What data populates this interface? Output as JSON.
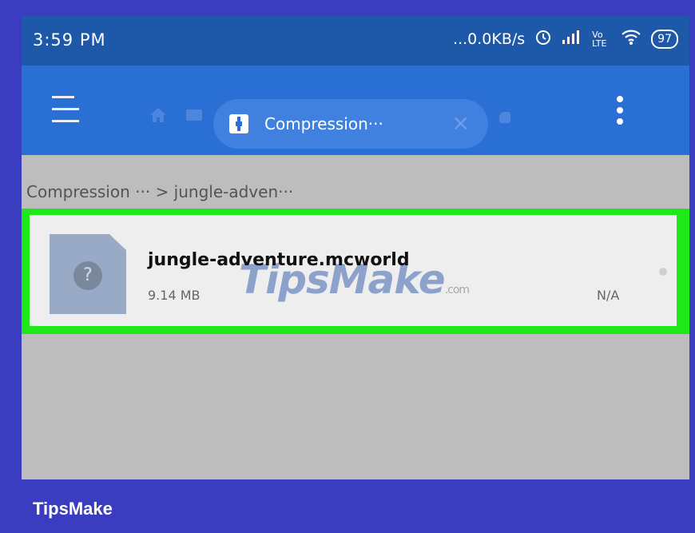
{
  "status": {
    "time": "3:59 PM",
    "speed": "...0.0KB/s",
    "volte": "Vo LTE",
    "battery": "97"
  },
  "toolbar": {
    "tab_label": "Compression···",
    "close_glyph": "×"
  },
  "breadcrumb": {
    "text": "Compression ··· > jungle-adven···"
  },
  "file": {
    "name": "jungle-adventure.mcworld",
    "size": "9.14 MB",
    "date": "N/A",
    "icon_glyph": "?"
  },
  "watermark": {
    "text": "TipsMake",
    "suffix": ".com"
  },
  "footer": {
    "brand": "TipsMake"
  },
  "colors": {
    "statusbar": "#1e58a8",
    "toolbar": "#2a6fd3",
    "highlight": "#1fe81a",
    "outer": "#3a3dbf"
  }
}
